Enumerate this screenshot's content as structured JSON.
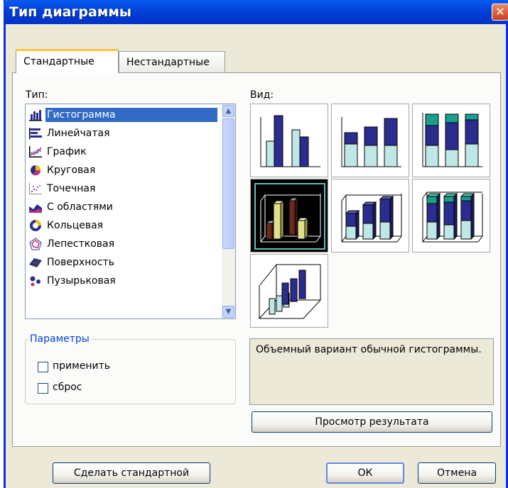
{
  "window": {
    "title": "Тип диаграммы",
    "close_glyph": "✕"
  },
  "tabs": [
    {
      "label": "Стандартные",
      "active": true
    },
    {
      "label": "Нестандартные",
      "active": false
    }
  ],
  "type_list": {
    "label": "Тип:",
    "items": [
      {
        "label": "Гистограмма",
        "icon": "histogram-icon",
        "selected": true
      },
      {
        "label": "Линейчатая",
        "icon": "bar-chart-icon"
      },
      {
        "label": "График",
        "icon": "line-chart-icon"
      },
      {
        "label": "Круговая",
        "icon": "pie-chart-icon"
      },
      {
        "label": "Точечная",
        "icon": "scatter-chart-icon"
      },
      {
        "label": "С областями",
        "icon": "area-chart-icon"
      },
      {
        "label": "Кольцевая",
        "icon": "doughnut-chart-icon"
      },
      {
        "label": "Лепестковая",
        "icon": "radar-chart-icon"
      },
      {
        "label": "Поверхность",
        "icon": "surface-chart-icon"
      },
      {
        "label": "Пузырьковая",
        "icon": "bubble-chart-icon"
      }
    ]
  },
  "view": {
    "label": "Вид:",
    "subtypes": [
      {
        "name": "clustered-column",
        "selected": false
      },
      {
        "name": "stacked-column",
        "selected": false
      },
      {
        "name": "100-stacked-column",
        "selected": false
      },
      {
        "name": "3d-clustered-column",
        "selected": true
      },
      {
        "name": "3d-stacked-column",
        "selected": false
      },
      {
        "name": "3d-100-stacked-column",
        "selected": false
      },
      {
        "name": "3d-column",
        "selected": false
      }
    ]
  },
  "params": {
    "legend": "Параметры",
    "apply_label": "применить",
    "reset_label": "сброс"
  },
  "description": "Объемный вариант обычной гистограммы.",
  "buttons": {
    "preview": "Просмотр результата",
    "make_default": "Сделать стандартной",
    "ok": "ОК",
    "cancel": "Отмена"
  },
  "colors": {
    "accent": "#316AC5",
    "titlebar": "#0040D8",
    "navy": "#2B2D8E",
    "teal": "#1B9E8E",
    "light": "#BEE7E5"
  }
}
